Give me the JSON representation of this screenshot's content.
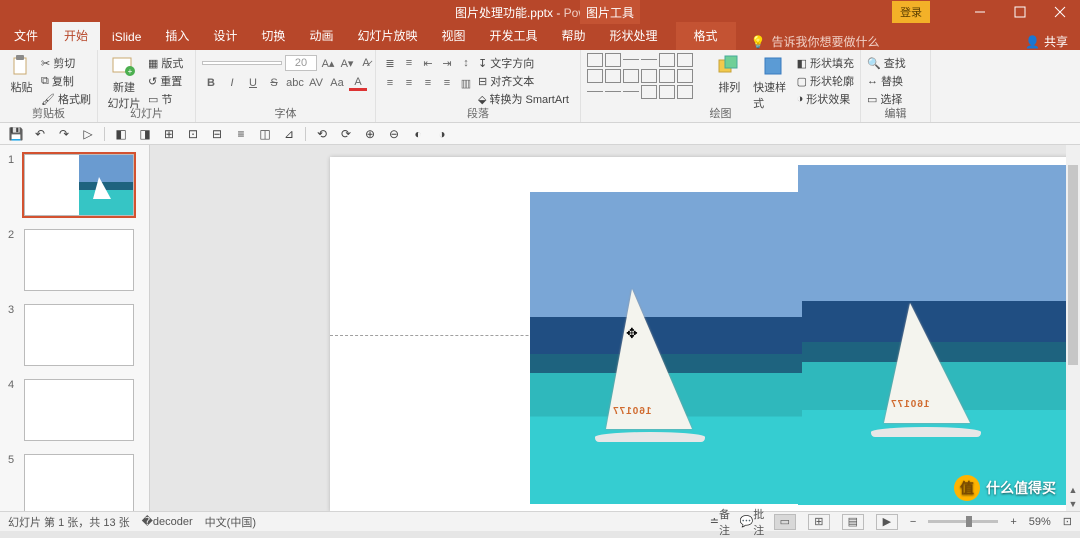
{
  "title": {
    "doc": "图片处理功能.pptx",
    "sep": " - ",
    "app": "PowerPoint",
    "context_group": "图片工具"
  },
  "window": {
    "login": "登录"
  },
  "tabs": {
    "file": "文件",
    "home": "开始",
    "islide": "iSlide",
    "insert": "插入",
    "design": "设计",
    "transitions": "切换",
    "animations": "动画",
    "slideshow": "幻灯片放映",
    "view": "视图",
    "developer": "开发工具",
    "help": "帮助",
    "shapeproc": "形状处理",
    "format": "格式"
  },
  "tell": {
    "placeholder": "告诉我你想要做什么"
  },
  "share": "共享",
  "ribbon": {
    "clipboard": {
      "label": "剪贴板",
      "paste": "粘贴",
      "cut": "剪切",
      "copy": "复制",
      "painter": "格式刷"
    },
    "slides": {
      "label": "幻灯片",
      "new": "新建\n幻灯片",
      "layout": "版式",
      "reset": "重置",
      "section": "节"
    },
    "font": {
      "label": "字体",
      "size": "20"
    },
    "paragraph": {
      "label": "段落",
      "textdir": "文字方向",
      "align": "对齐文本",
      "smartart": "转换为 SmartArt"
    },
    "drawing": {
      "label": "绘图",
      "arrange": "排列",
      "quickstyle": "快速样式",
      "fill": "形状填充",
      "outline": "形状轮廓",
      "effects": "形状效果"
    },
    "editing": {
      "label": "编辑",
      "find": "查找",
      "replace": "替换",
      "select": "选择"
    }
  },
  "thumbs": [
    "1",
    "2",
    "3",
    "4",
    "5"
  ],
  "sailmark": "160177",
  "status": {
    "slideinfo": "幻灯片 第 1 张，共 13 张",
    "lang": "中文(中国)",
    "notes": "备注",
    "comments": "批注",
    "zoom": "59%"
  },
  "watermark": "什么值得买"
}
